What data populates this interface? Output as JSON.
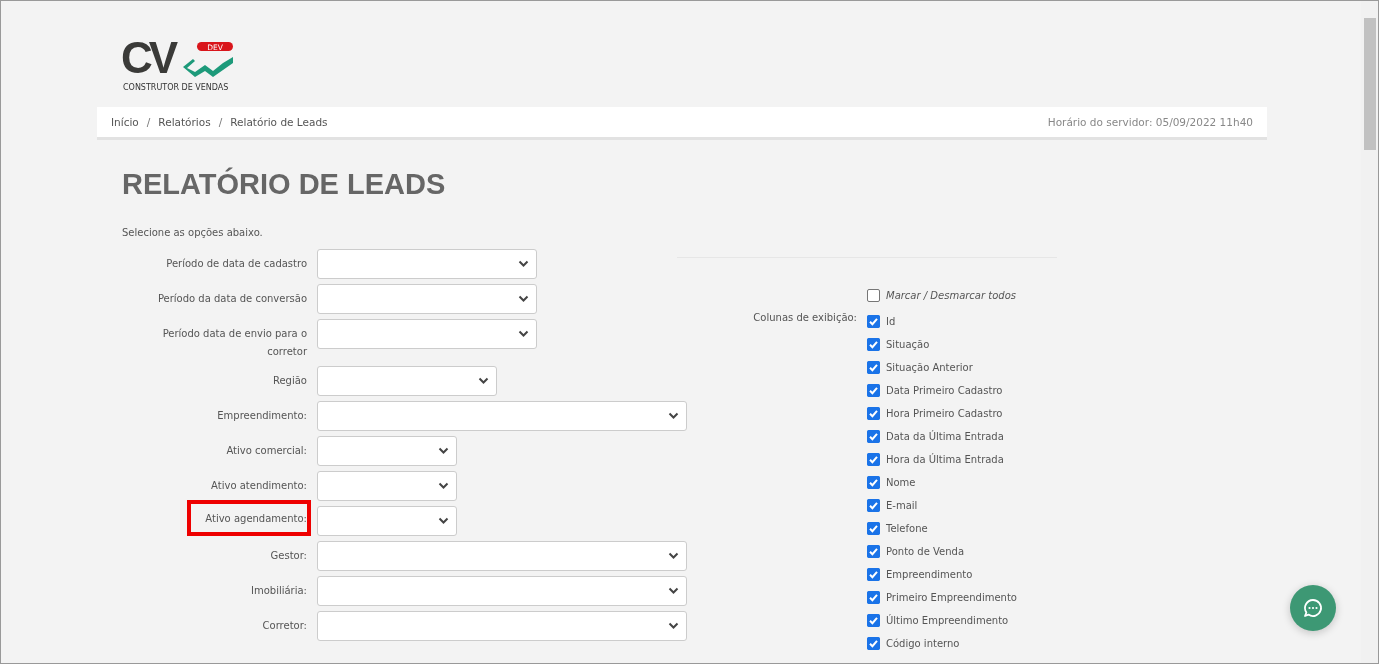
{
  "logo": {
    "letters": "CV",
    "badge": "DEV",
    "tagline": "CONSTRUTOR DE VENDAS"
  },
  "breadcrumb": [
    {
      "label": "Início",
      "separator": "/"
    },
    {
      "label": "Relatórios",
      "separator": "/"
    },
    {
      "label": "Relatório de Leads"
    }
  ],
  "server_time": "Horário do servidor: 05/09/2022 11h40",
  "title": "RELATÓRIO DE LEADS",
  "instructions": "Selecione as opções abaixo.",
  "filters": [
    {
      "label": "Período de data de cadastro",
      "kind": "period",
      "highlighted": false
    },
    {
      "label": "Período da data de conversão",
      "kind": "period",
      "highlighted": false
    },
    {
      "label": "Período data de envio para o corretor",
      "kind": "period",
      "highlighted": false
    },
    {
      "label": "Região",
      "kind": "region",
      "highlighted": false
    },
    {
      "label": "Empreendimento:",
      "kind": "entity",
      "highlighted": false
    },
    {
      "label": "Ativo comercial:",
      "kind": "flag",
      "highlighted": false
    },
    {
      "label": "Ativo atendimento:",
      "kind": "flag",
      "highlighted": false
    },
    {
      "label": "Ativo agendamento:",
      "kind": "flag",
      "highlighted": true
    },
    {
      "label": "Gestor:",
      "kind": "entity",
      "highlighted": false
    },
    {
      "label": "Imobiliária:",
      "kind": "entity",
      "highlighted": false
    },
    {
      "label": "Corretor:",
      "kind": "entity",
      "highlighted": false
    }
  ],
  "toggle_all": {
    "label": "Marcar / Desmarcar todos",
    "checked": false
  },
  "columns_label": "Colunas de exibição:",
  "columns": [
    {
      "label": "Id",
      "checked": true
    },
    {
      "label": "Situação",
      "checked": true
    },
    {
      "label": "Situação Anterior",
      "checked": true
    },
    {
      "label": "Data Primeiro Cadastro",
      "checked": true
    },
    {
      "label": "Hora Primeiro Cadastro",
      "checked": true
    },
    {
      "label": "Data da Última Entrada",
      "checked": true
    },
    {
      "label": "Hora da Última Entrada",
      "checked": true
    },
    {
      "label": "Nome",
      "checked": true
    },
    {
      "label": "E-mail",
      "checked": true
    },
    {
      "label": "Telefone",
      "checked": true
    },
    {
      "label": "Ponto de Venda",
      "checked": true
    },
    {
      "label": "Empreendimento",
      "checked": true
    },
    {
      "label": "Primeiro Empreendimento",
      "checked": true
    },
    {
      "label": "Último Empreendimento",
      "checked": true
    },
    {
      "label": "Código interno",
      "checked": true
    }
  ]
}
